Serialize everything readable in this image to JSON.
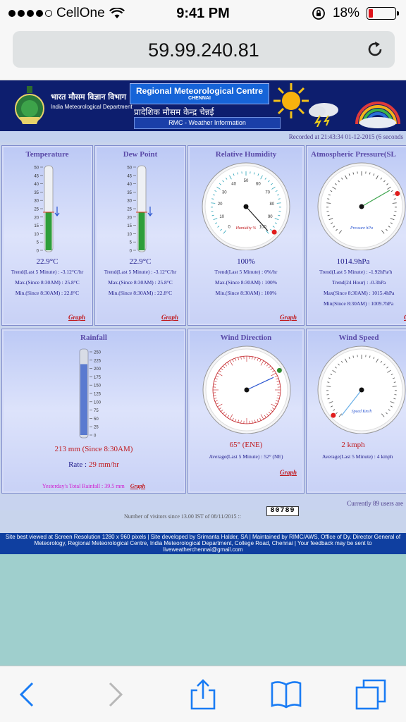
{
  "status": {
    "carrier": "CellOne",
    "time": "9:41 PM",
    "battery": "18%",
    "battery_level": 0.18
  },
  "browser": {
    "url": "59.99.240.81"
  },
  "header": {
    "hindi_dept": "भारत मौसम विज्ञान विभाग",
    "imd": "India Meteorological Department",
    "rmc": "Regional Meteorological Centre",
    "rmc_city": "CHENNAI",
    "rmc_hindi": "प्रादेशिक मौसम केन्द्र चेन्नई",
    "rmc_info": "RMC - Weather Information"
  },
  "recorded": "Recorded at 21:43:34 01-12-2015 (6 seconds",
  "temperature": {
    "title": "Temperature",
    "value": "22.9°C",
    "trend": "Trend(Last 5 Minute) : -3.12°C/hr",
    "max": "Max.(Since 8:30AM) : 25.8°C",
    "min": "Min.(Since 8:30AM) : 22.8°C",
    "graph": "Graph",
    "ticks": [
      "50",
      "45",
      "40",
      "35",
      "30",
      "25",
      "20",
      "15",
      "10",
      "5",
      "0"
    ],
    "level": 22.9
  },
  "dewpoint": {
    "title": "Dew Point",
    "value": "22.9°C",
    "trend": "Trend(Last 5 Minute) : -3.12°C/hr",
    "max": "Max.(Since 8:30AM) : 25.8°C",
    "min": "Min.(Since 8:30AM) : 22.8°C",
    "graph": "Graph",
    "ticks": [
      "50",
      "45",
      "40",
      "35",
      "30",
      "25",
      "20",
      "15",
      "10",
      "5",
      "0"
    ],
    "level": 22.9
  },
  "humidity": {
    "title": "Relative Humidity",
    "value": "100%",
    "trend": "Trend(Last 5 Minute) : 0%/hr",
    "max": "Max.(Since 8:30AM) : 100%",
    "min": "Min.(Since 8:30AM) : 100%",
    "graph": "Graph",
    "dial_label": "Humidity %",
    "dial_ticks": [
      "0",
      "10",
      "20",
      "30",
      "40",
      "50",
      "60",
      "70",
      "80",
      "90",
      "100"
    ]
  },
  "pressure": {
    "title": "Atmospheric Pressure(SL",
    "value": "1014.9hPa",
    "trend5": "Trend(Last 5 Minute) : -1.92hPa/h",
    "trend24": "Trend(24 Hour) : -0.3hPa",
    "max": "Max(Since 8:30AM) : 1015.4hPa",
    "min": "Min(Since 8:30AM) : 1009.7hPa",
    "graph": "Gr",
    "dial_label": "Pressure hPa"
  },
  "rainfall": {
    "title": "Rainfall",
    "value": "213 mm (Since 8:30AM)",
    "rate_label": "Rate :",
    "rate": "29 mm/hr",
    "yesterday": "Yesterday's Total Rainfall : 39.5 mm",
    "graph": "Graph",
    "ticks": [
      "250",
      "225",
      "200",
      "175",
      "150",
      "125",
      "100",
      "75",
      "50",
      "25",
      "0"
    ],
    "level": 213
  },
  "wind_direction": {
    "title": "Wind Direction",
    "value": "65° (ENE)",
    "average": "Average(Last 5 Minute) : 52° (NE)",
    "graph": "Graph",
    "degrees": 65
  },
  "wind_speed": {
    "title": "Wind Speed",
    "value": "2 kmph",
    "average": "Average(Last 5 Minute) : 4 kmph",
    "graph": "G",
    "dial_label": "Speed Km/h"
  },
  "users": "Currently 89 users are",
  "visitors_text": "Number of visitors since 13.00 IST of 08/11/2015 ::",
  "visitor_count": "80789",
  "footer": "Site best viewed at Screen Resolution 1280 x 960 pixels | Site developed by Srimanta Halder, SA | Maintained by RIMC/AWS, Office of Dy. Director General of Meteorology, Regional Meteorological Centre, India Meteorological Department, College Road, Chennai | Your feedback may be sent to liveweatherchennai@gmail.com",
  "colors": {
    "header": "#0d1e6e",
    "panel_title": "#5a4aa8",
    "value_red": "#c0191e",
    "thermo_green": "#2e9e3a"
  }
}
